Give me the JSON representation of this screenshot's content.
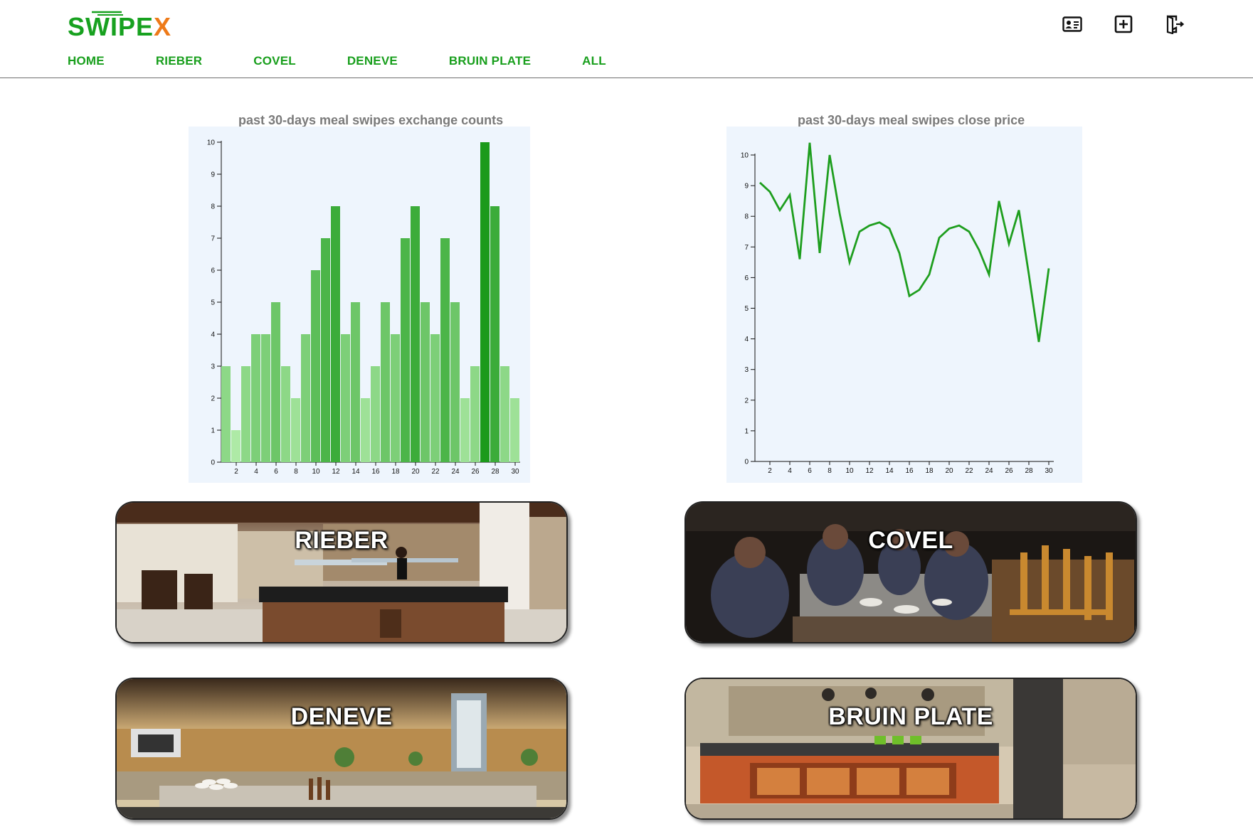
{
  "app": {
    "logo": {
      "prefix": "SWIPE",
      "suffix": "X",
      "colors": {
        "green": "#17a11f",
        "orange": "#ee7a18"
      }
    }
  },
  "nav": {
    "items": [
      {
        "label": "HOME"
      },
      {
        "label": "RIEBER"
      },
      {
        "label": "COVEL"
      },
      {
        "label": "DENEVE"
      },
      {
        "label": "BRUIN PLATE"
      },
      {
        "label": "ALL"
      }
    ],
    "color": "#199f1d"
  },
  "toolbar": {
    "icons": [
      "id-card-icon",
      "plus-square-icon",
      "logout-icon"
    ]
  },
  "charts": {
    "counts": {
      "title": "past 30-days meal swipes exchange counts"
    },
    "price": {
      "title": "past 30-days meal swipes close price"
    }
  },
  "chart_data": [
    {
      "type": "bar",
      "title": "past 30-days meal swipes exchange counts",
      "x": [
        1,
        2,
        3,
        4,
        5,
        6,
        7,
        8,
        9,
        10,
        11,
        12,
        13,
        14,
        15,
        16,
        17,
        18,
        19,
        20,
        21,
        22,
        23,
        24,
        25,
        26,
        27,
        28,
        29,
        30
      ],
      "values": [
        3,
        1,
        3,
        4,
        4,
        5,
        3,
        2,
        4,
        6,
        7,
        8,
        4,
        5,
        2,
        3,
        5,
        4,
        7,
        8,
        5,
        4,
        7,
        5,
        2,
        3,
        10,
        8,
        3,
        2
      ],
      "x_ticks": [
        2,
        4,
        6,
        8,
        10,
        12,
        14,
        16,
        18,
        20,
        22,
        24,
        26,
        28,
        30
      ],
      "y_ticks": [
        0,
        1,
        2,
        3,
        4,
        5,
        6,
        7,
        8,
        9,
        10
      ],
      "ylim": [
        0,
        10
      ],
      "color_scale": [
        "#aeeaa6",
        "#1b9a1b"
      ],
      "grid": false
    },
    {
      "type": "line",
      "title": "past 30-days meal swipes close price",
      "x": [
        1,
        2,
        3,
        4,
        5,
        6,
        7,
        8,
        9,
        10,
        11,
        12,
        13,
        14,
        15,
        16,
        17,
        18,
        19,
        20,
        21,
        22,
        23,
        24,
        25,
        26,
        27,
        28,
        29,
        30
      ],
      "values": [
        9.1,
        8.8,
        8.2,
        8.7,
        6.6,
        10.4,
        6.8,
        10,
        8.1,
        6.5,
        7.5,
        7.7,
        7.8,
        7.6,
        6.8,
        5.4,
        5.6,
        6.1,
        7.3,
        7.6,
        7.7,
        7.5,
        6.9,
        6.1,
        8.5,
        7.1,
        8.2,
        6.1,
        3.9,
        6.3
      ],
      "x_ticks": [
        2,
        4,
        6,
        8,
        10,
        12,
        14,
        16,
        18,
        20,
        22,
        24,
        26,
        28,
        30
      ],
      "y_ticks": [
        0,
        1,
        2,
        3,
        4,
        5,
        6,
        7,
        8,
        9,
        10
      ],
      "ylim": [
        0,
        10
      ],
      "color": "#1e9e1e",
      "grid": false
    }
  ],
  "dining_halls": [
    {
      "label": "RIEBER",
      "scene": "rieber"
    },
    {
      "label": "COVEL",
      "scene": "covel"
    },
    {
      "label": "DENEVE",
      "scene": "deneve"
    },
    {
      "label": "BRUIN PLATE",
      "scene": "bruinplate"
    }
  ]
}
